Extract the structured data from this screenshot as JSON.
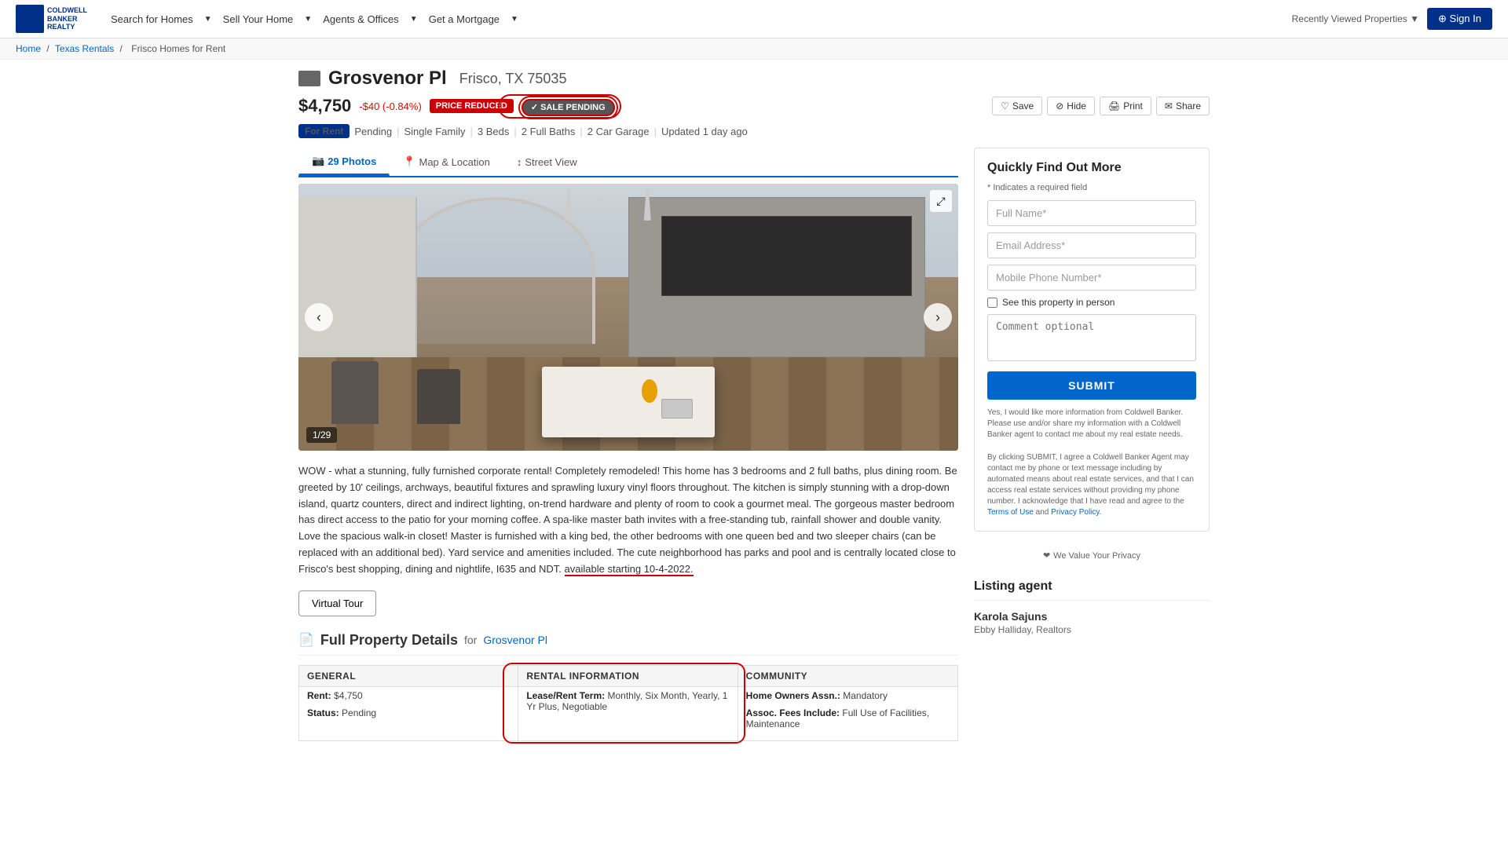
{
  "nav": {
    "logo_line1": "COLDWELL",
    "logo_line2": "BANKER",
    "logo_line3": "REALTY",
    "links": [
      {
        "label": "Search for Homes",
        "has_dropdown": true
      },
      {
        "label": "Sell Your Home",
        "has_dropdown": true
      },
      {
        "label": "Agents & Offices",
        "has_dropdown": true
      },
      {
        "label": "Get a Mortgage",
        "has_dropdown": true
      }
    ],
    "recently_viewed": "Recently Viewed Properties ▼",
    "sign_in": "⊕ Sign In"
  },
  "breadcrumb": {
    "home": "Home",
    "separator1": "/",
    "texas_rentals": "Texas Rentals",
    "separator2": "/",
    "frisco": "Frisco Homes for Rent"
  },
  "property": {
    "title": "Grosvenor Pl",
    "location": "Frisco, TX 75035",
    "price": "$4,750",
    "price_change": "-$40 (-0.84%)",
    "badge_price_reduced": "PRICE REDUCED",
    "badge_sale_pending": "SALE PENDING",
    "status_for_rent": "For Rent",
    "status_pending": "Pending",
    "type": "Single Family",
    "beds": "3 Beds",
    "baths": "2 Full Baths",
    "garage": "2 Car Garage",
    "updated": "Updated 1 day ago",
    "photo_counter": "1/29",
    "action_save": "Save",
    "action_hide": "Hide",
    "action_print": "Print",
    "action_share": "Share"
  },
  "tabs": [
    {
      "label": "29 Photos",
      "icon": "📷",
      "active": true
    },
    {
      "label": "Map & Location",
      "icon": "📍",
      "active": false
    },
    {
      "label": "Street View",
      "icon": "↕",
      "active": false
    }
  ],
  "description": {
    "text": "WOW - what a stunning, fully furnished corporate rental! Completely remodeled! This home has 3 bedrooms and 2 full baths, plus dining room. Be greeted by 10' ceilings, archways, beautiful fixtures and sprawling luxury vinyl floors throughout. The kitchen is simply stunning with a drop-down island, quartz counters, direct and indirect lighting, on-trend hardware and plenty of room to cook a gourmet meal. The gorgeous master bedroom has direct access to the patio for your morning coffee. A spa-like master bath invites with a free-standing tub, rainfall shower and double vanity. Love the spacious walk-in closet! Master is furnished with a king bed, the other bedrooms with one queen bed and two sleeper chairs (can be replaced with an additional bed). Yard service and amenities included. The cute neighborhood has parks and pool and is centrally located close to Frisco's best shopping, dining and nightlife, I635 and NDT.",
    "highlighted_part": "available starting 10-4-2022."
  },
  "virtual_tour": {
    "label": "Virtual Tour"
  },
  "full_details": {
    "title": "Full Property Details",
    "for_text": "for",
    "address_icon": "📄",
    "general": {
      "header": "GENERAL",
      "items": [
        {
          "label": "Rent:",
          "value": "$4,750"
        },
        {
          "label": "Status:",
          "value": "Pending"
        }
      ]
    },
    "rental_info": {
      "header": "RENTAL INFORMATION",
      "items": [
        {
          "label": "Lease/Rent Term:",
          "value": "Monthly, Six Month, Yearly, 1 Yr Plus, Negotiable"
        }
      ]
    },
    "community": {
      "header": "COMMUNITY",
      "items": [
        {
          "label": "Home Owners Assn.:",
          "value": "Mandatory"
        },
        {
          "label": "Assoc. Fees Include:",
          "value": "Full Use of Facilities, Maintenance"
        }
      ]
    }
  },
  "quick_form": {
    "title": "Quickly Find Out More",
    "required_note": "* Indicates a required field",
    "full_name_placeholder": "Full Name*",
    "email_placeholder": "Email Address*",
    "phone_placeholder": "Mobile Phone Number*",
    "checkbox_label": "See this property in person",
    "comment_placeholder": "Comment optional",
    "submit_label": "SUBMIT",
    "disclaimer1": "Yes, I would like more information from Coldwell Banker. Please use and/or share my information with a Coldwell Banker agent to contact me about my real estate needs.",
    "disclaimer2": "By clicking SUBMIT, I agree a Coldwell Banker Agent may contact me by phone or text message including by automated means about real estate services, and that I can access real estate services without providing my phone number. I acknowledge that I have read and agree to the Terms of Use and Privacy Policy.",
    "privacy_text": "We Value Your Privacy",
    "terms_link": "Terms of Use",
    "privacy_link": "Privacy Policy"
  },
  "listing_agent": {
    "title": "Listing agent",
    "agent_name": "Karola Sajuns",
    "agent_company": "Ebby Halliday, Realtors"
  }
}
